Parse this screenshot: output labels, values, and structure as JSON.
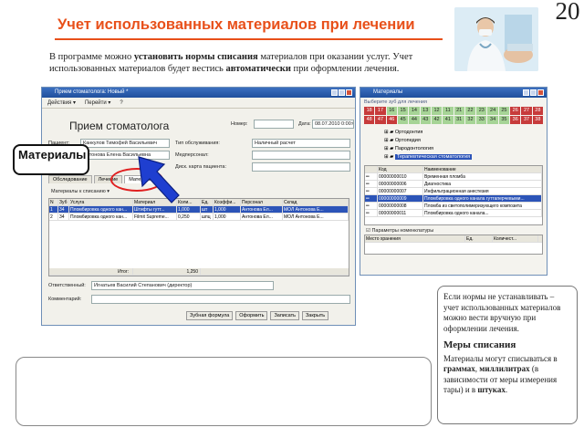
{
  "header": {
    "title": "Учет использованных материалов при лечении",
    "page_number": "20"
  },
  "intro": {
    "p1": "В программе можно ",
    "b1": "установить нормы списания",
    "p2": " материалов при оказании услуг. Учет использованных материалов будет вестись ",
    "b2": "автоматически",
    "p3": " при оформлении лечения."
  },
  "left_window": {
    "title": "Прием стоматолога: Новый *",
    "toolbar": [
      "Действия ▾",
      "Перейти ▾",
      "?"
    ],
    "doc_title": "Прием стоматолога",
    "number_label": "Номер:",
    "date_label": "Дата:",
    "date_value": "08.07.2010 0:00:00",
    "patient_label": "Пациент:",
    "patient_value": "Канкулов Тимофей Васильевич",
    "service_type_label": "Тип обслуживания:",
    "service_type_value": "Наличный расчет",
    "doctor_value": "Антонова Елена Васильевна",
    "medstaff_label": "Медперсонал:",
    "disc_label": "Диск. карта пациента:",
    "tabs": [
      "Обследование",
      "Лечение",
      "Материалы"
    ],
    "sub_toolbar": "Материалы к списанию ▾",
    "columns": [
      "N",
      "Зуб",
      "Услуга",
      "Материал",
      "Коли...",
      "Ед.",
      "Коэффи...",
      "Персонал",
      "Склад"
    ],
    "rows": [
      [
        "1",
        "34",
        "Пломбировка одного кан...",
        "Штифты гутт...",
        "1,000",
        "шт",
        "1,000",
        "Антонова Ел...",
        "МОЛ Антонова Е..."
      ],
      [
        "2",
        "34",
        "Пломбировка одного кан...",
        "Filmit Supreme...",
        "0,250",
        "шпц",
        "1,000",
        "Антонова Ел...",
        "МОЛ Антонова Е..."
      ]
    ],
    "total_label": "Итог:",
    "total_value": "1,250",
    "responsible_label": "Ответственный:",
    "responsible_value": "Игнатьев Василий Степанович (директор)",
    "comment_label": "Комментарий:",
    "buttons": [
      "Зубная формула",
      "Оформить",
      "Записать",
      "Закрыть"
    ]
  },
  "right_window": {
    "title": "Материалы",
    "subtitle": "Выберите зуб для лечения",
    "teeth_row1": [
      "18",
      "17",
      "16",
      "15",
      "14",
      "13",
      "12",
      "11",
      "21",
      "22",
      "23",
      "24",
      "25",
      "26",
      "27",
      "28"
    ],
    "teeth_row2": [
      "48",
      "47",
      "46",
      "45",
      "44",
      "43",
      "42",
      "41",
      "31",
      "32",
      "33",
      "34",
      "35",
      "36",
      "37",
      "38"
    ],
    "tree": [
      "Ортодонтия",
      "Ортопедия",
      "Пародонтология",
      "Терапевтическая стоматология"
    ],
    "columns": [
      "Код",
      "Наименование"
    ],
    "rows": [
      [
        "00000000010",
        "Временная пломба"
      ],
      [
        "00000000006",
        "Диагностика"
      ],
      [
        "00000000007",
        "Инфильтрационная анестезия"
      ],
      [
        "00000000009",
        "Пломбировка одного канала гуттаперчевыми..."
      ],
      [
        "00000000008",
        "Пломба из светополимеризующего композита"
      ],
      [
        "00000000011",
        "Пломбировка одного канала..."
      ]
    ],
    "params_label": "Параметры номенклатуры",
    "params_columns": [
      "Место хранения",
      "Ед.",
      "Количест..."
    ]
  },
  "callout": {
    "text": "Материалы"
  },
  "note": {
    "p1": "Если нормы не устанавливать – учет использованных материалов можно вести вручную при оформлении лечения.",
    "heading": "Меры списания",
    "p2a": "Материалы могут списываться в ",
    "p2b": "граммах",
    "p2c": ", ",
    "p2d": "миллилитрах",
    "p2e": " (в зависимости от меры измерения тары) и в ",
    "p2f": "штуках",
    "p2g": "."
  },
  "colors": {
    "title": "#e8501a",
    "highlight_ellipse": "#e02020",
    "arrow": "#1f3fd0",
    "tooth_selected": "#c73b3b",
    "tooth_normal": "#a6d496"
  }
}
